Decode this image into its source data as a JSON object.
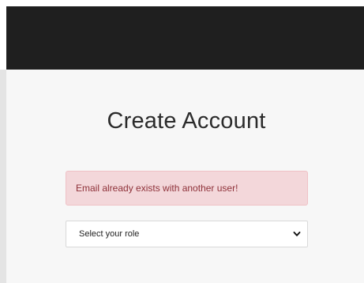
{
  "form": {
    "title": "Create Account",
    "alert_message": "Email already exists with another user!",
    "role_select": {
      "selected": "Select your role"
    }
  },
  "colors": {
    "header_bg": "#1f1f1f",
    "alert_bg": "#f3d7da",
    "alert_text": "#8e3139"
  },
  "icons": {
    "select_chevron": "chevron-down-icon"
  }
}
